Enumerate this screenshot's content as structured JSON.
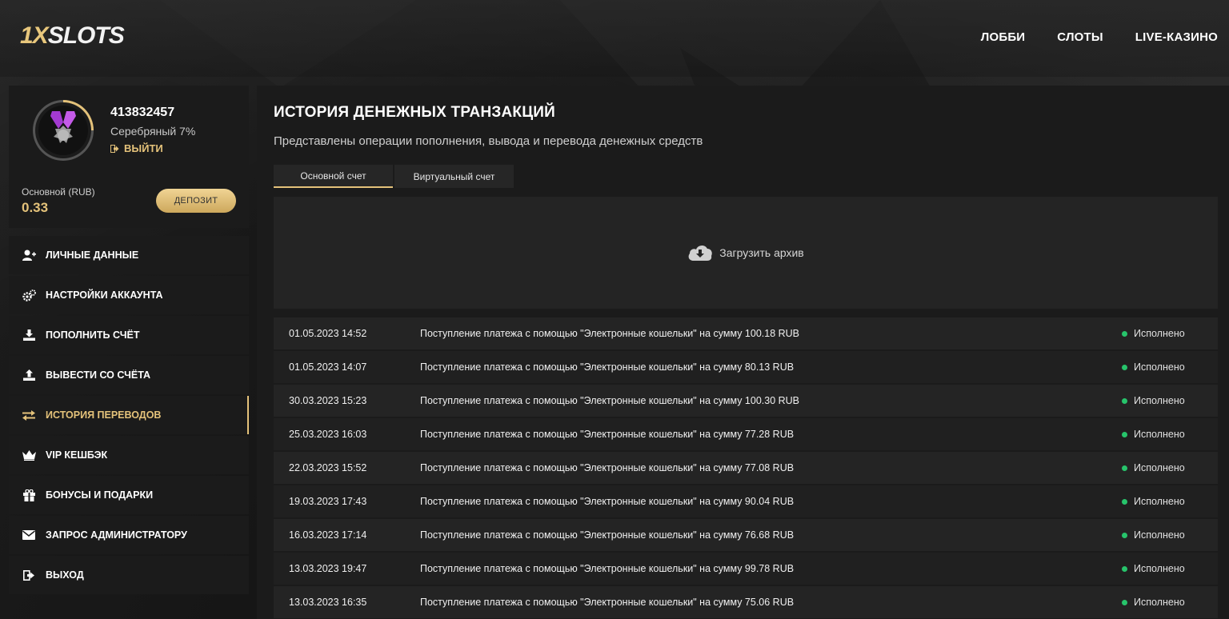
{
  "logo": {
    "part1": "1X",
    "part2": "SLOTS"
  },
  "nav": [
    {
      "label": "ЛОББИ"
    },
    {
      "label": "СЛОТЫ"
    },
    {
      "label": "LIVE-КАЗИНО"
    }
  ],
  "profile": {
    "user_id": "413832457",
    "rank": "Серебряный 7%",
    "logout_label": "ВЫЙТИ",
    "balance_label": "Основной (RUB)",
    "balance_value": "0.33",
    "deposit_label": "ДЕПОЗИТ",
    "accent_color": "#e4c27a"
  },
  "menu": [
    {
      "label": "ЛИЧНЫЕ ДАННЫЕ",
      "icon": "user-plus-icon"
    },
    {
      "label": "НАСТРОЙКИ АККАУНТА",
      "icon": "gears-icon"
    },
    {
      "label": "ПОПОЛНИТЬ СЧЁТ",
      "icon": "download-icon"
    },
    {
      "label": "ВЫВЕСТИ СО СЧЁТА",
      "icon": "upload-icon"
    },
    {
      "label": "ИСТОРИЯ ПЕРЕВОДОВ",
      "icon": "transfer-icon",
      "active": true
    },
    {
      "label": "VIP КЕШБЭК",
      "icon": "crown-icon"
    },
    {
      "label": "БОНУСЫ И ПОДАРКИ",
      "icon": "gift-icon"
    },
    {
      "label": "ЗАПРОС АДМИНИСТРАТОРУ",
      "icon": "envelope-icon"
    },
    {
      "label": "ВЫХОД",
      "icon": "sign-out-icon"
    }
  ],
  "main": {
    "title": "ИСТОРИЯ ДЕНЕЖНЫХ ТРАНЗАКЦИЙ",
    "subtitle": "Представлены операции пополнения, вывода и перевода денежных средств",
    "tabs": [
      {
        "label": "Основной счет",
        "active": true
      },
      {
        "label": "Виртуальный счет"
      }
    ],
    "archive_label": "Загрузить архив"
  },
  "transactions": [
    {
      "date": "01.05.2023 14:52",
      "desc": "Поступление платежа с помощью \"Электронные кошельки\" на сумму 100.18 RUB",
      "status": "Исполнено"
    },
    {
      "date": "01.05.2023 14:07",
      "desc": "Поступление платежа с помощью \"Электронные кошельки\" на сумму 80.13 RUB",
      "status": "Исполнено"
    },
    {
      "date": "30.03.2023 15:23",
      "desc": "Поступление платежа с помощью \"Электронные кошельки\" на сумму 100.30 RUB",
      "status": "Исполнено"
    },
    {
      "date": "25.03.2023 16:03",
      "desc": "Поступление платежа с помощью \"Электронные кошельки\" на сумму 77.28 RUB",
      "status": "Исполнено"
    },
    {
      "date": "22.03.2023 15:52",
      "desc": "Поступление платежа с помощью \"Электронные кошельки\" на сумму 77.08 RUB",
      "status": "Исполнено"
    },
    {
      "date": "19.03.2023 17:43",
      "desc": "Поступление платежа с помощью \"Электронные кошельки\" на сумму 90.04 RUB",
      "status": "Исполнено"
    },
    {
      "date": "16.03.2023 17:14",
      "desc": "Поступление платежа с помощью \"Электронные кошельки\" на сумму 76.68 RUB",
      "status": "Исполнено"
    },
    {
      "date": "13.03.2023 19:47",
      "desc": "Поступление платежа с помощью \"Электронные кошельки\" на сумму 99.78 RUB",
      "status": "Исполнено"
    },
    {
      "date": "13.03.2023 16:35",
      "desc": "Поступление платежа с помощью \"Электронные кошельки\" на сумму 75.06 RUB",
      "status": "Исполнено"
    }
  ],
  "status_color": "#27c46b"
}
